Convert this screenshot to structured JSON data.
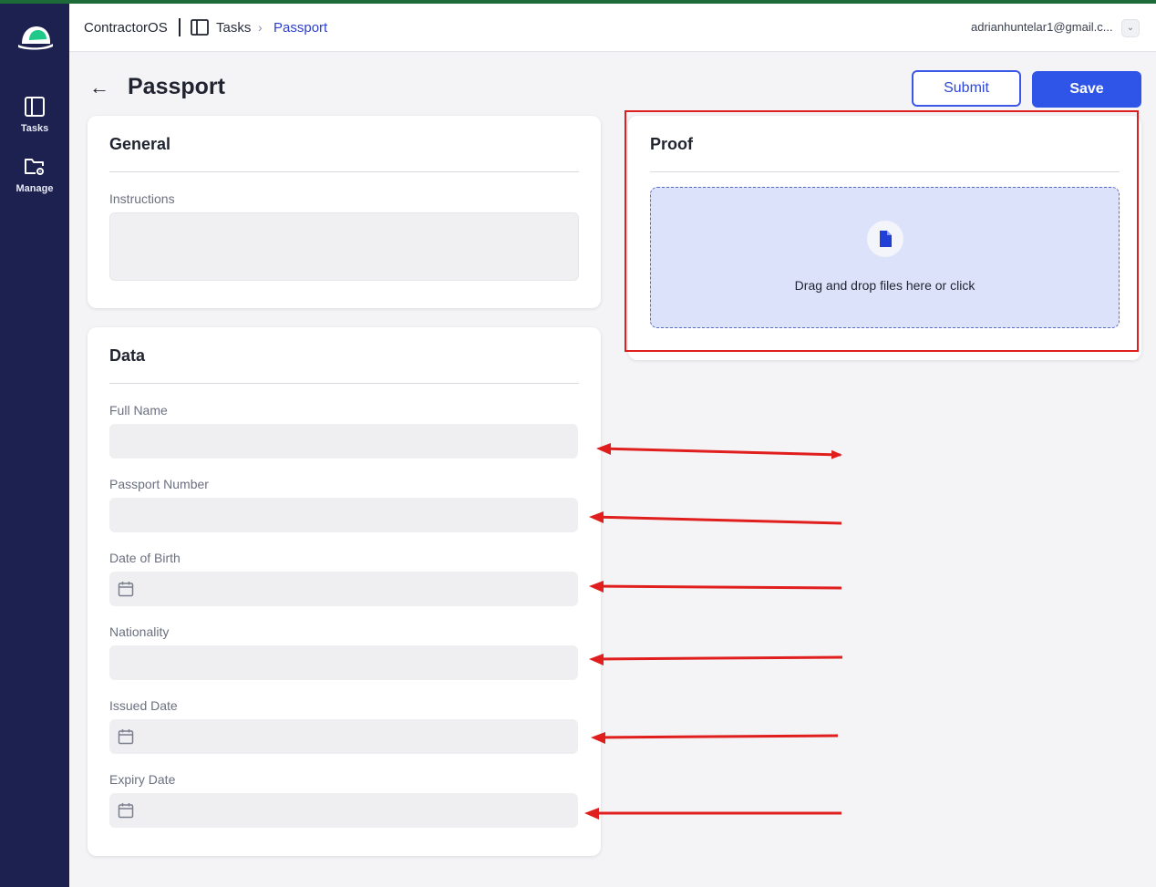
{
  "app": {
    "brand": "ContractorOS"
  },
  "sidebar": {
    "items": [
      {
        "label": "Tasks",
        "icon": "tasks-panel-icon"
      },
      {
        "label": "Manage",
        "icon": "folder-settings-icon"
      }
    ]
  },
  "breadcrumb": {
    "section": "Tasks",
    "current": "Passport"
  },
  "user": {
    "email": "adrianhuntelar1@gmail.c..."
  },
  "page": {
    "title": "Passport"
  },
  "actions": {
    "submit": "Submit",
    "save": "Save"
  },
  "general": {
    "title": "General",
    "instructions_label": "Instructions",
    "instructions_value": ""
  },
  "data_section": {
    "title": "Data",
    "fields": [
      {
        "label": "Full Name",
        "type": "text",
        "value": ""
      },
      {
        "label": "Passport Number",
        "type": "text",
        "value": ""
      },
      {
        "label": "Date of Birth",
        "type": "date",
        "value": ""
      },
      {
        "label": "Nationality",
        "type": "text",
        "value": ""
      },
      {
        "label": "Issued Date",
        "type": "date",
        "value": ""
      },
      {
        "label": "Expiry Date",
        "type": "date",
        "value": ""
      }
    ]
  },
  "proof": {
    "title": "Proof",
    "dropzone_text": "Drag and drop files here or click"
  },
  "colors": {
    "sidebar": "#1c2150",
    "accent": "#2f55e8",
    "annotation": "#e01e1e",
    "dropzone": "#dde2fb"
  }
}
